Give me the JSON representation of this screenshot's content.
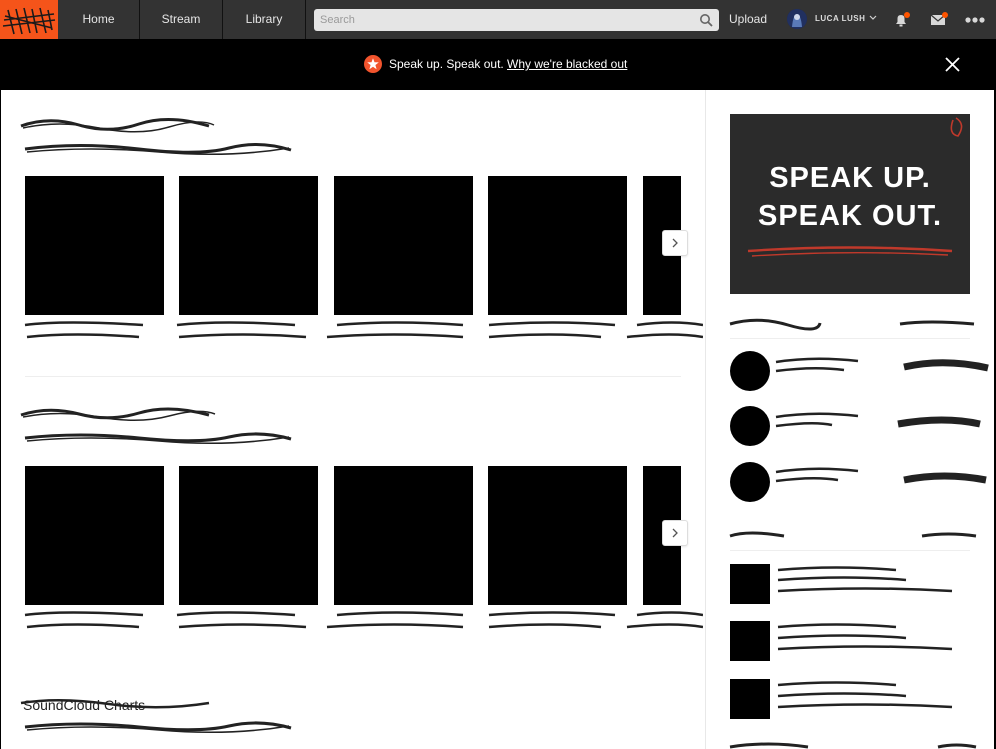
{
  "nav": {
    "home_label": "Home",
    "stream_label": "Stream",
    "library_label": "Library",
    "search_placeholder": "Search",
    "upload_label": "Upload",
    "username": "LUCA LUSH"
  },
  "banner": {
    "text": "Speak up. Speak out.",
    "link": "Why we're blacked out"
  },
  "sections": [
    {
      "title": ""
    },
    {
      "title": ""
    },
    {
      "title": "SoundCloud Charts"
    }
  ],
  "ad": {
    "line1": "SPEAK UP.",
    "line2": "SPEAK OUT."
  },
  "colors": {
    "brand": "#ff5500",
    "nav_bg": "#333333",
    "banner_bg": "#000000",
    "ad_bg": "#2b2b2b"
  }
}
